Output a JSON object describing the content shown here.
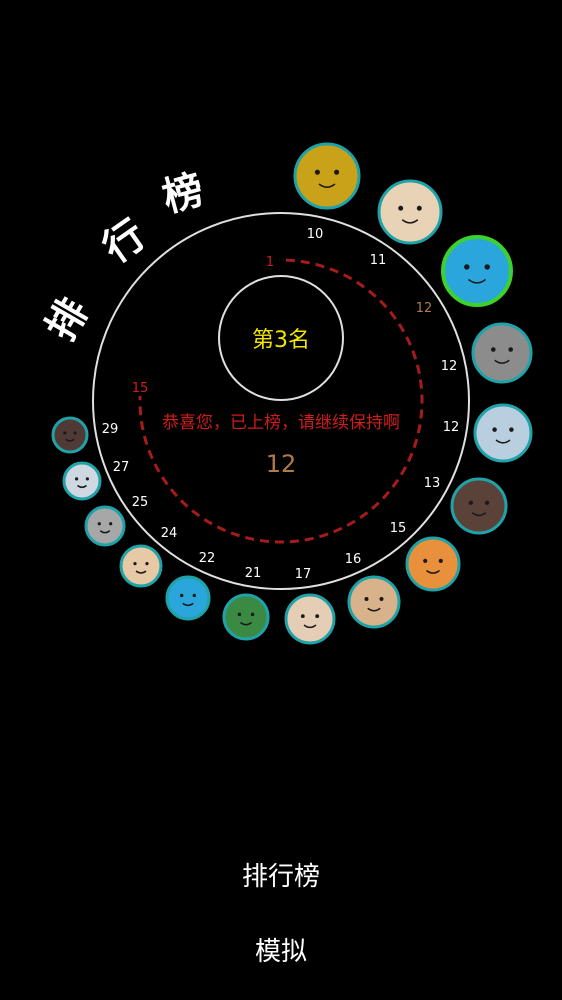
{
  "title_chars": [
    "排",
    "行",
    "榜"
  ],
  "rank_text": "第3名",
  "message": "恭喜您，已上榜，请继续保持啊",
  "score": "12",
  "arc_start_label": "1",
  "arc_end_label": "15",
  "ring_labels": [
    "10",
    "11",
    "12",
    "12",
    "12",
    "13",
    "15",
    "16",
    "17",
    "21",
    "22",
    "24",
    "25",
    "27",
    "29"
  ],
  "highlight_index": 2,
  "avatars": [
    {
      "name": "avatar-emoji-face",
      "color": "#c9a21a"
    },
    {
      "name": "avatar-girl-pink-dress",
      "color": "#e8d3b7"
    },
    {
      "name": "avatar-blue-monster",
      "color": "#2aa6dd"
    },
    {
      "name": "avatar-gray-sketch-boy",
      "color": "#8c8c8c"
    },
    {
      "name": "avatar-cartoon-rabbit",
      "color": "#b9cfe0"
    },
    {
      "name": "avatar-girl-dark-hair",
      "color": "#5a4238"
    },
    {
      "name": "avatar-boy-orange-shirt",
      "color": "#e8903c"
    },
    {
      "name": "avatar-blond-kid",
      "color": "#d7b28a"
    },
    {
      "name": "avatar-red-hair-girl",
      "color": "#e6cdb5"
    },
    {
      "name": "avatar-boy-green-shirt",
      "color": "#3a8a44"
    },
    {
      "name": "avatar-blue-monster-small",
      "color": "#2aa6dd"
    },
    {
      "name": "avatar-girl-long-hair",
      "color": "#e7c9a6"
    },
    {
      "name": "avatar-sketch-character",
      "color": "#a7a7a7"
    },
    {
      "name": "avatar-sketch-rabbit",
      "color": "#cfd8e0"
    },
    {
      "name": "avatar-dark-hair-child",
      "color": "#503a35"
    }
  ],
  "colors": {
    "ring": "#e0e0e0",
    "dash_arc": "#a61c1c",
    "rank_text": "#f2e600",
    "message": "#d01c1c",
    "score": "#b07a4a",
    "highlight_label": "#b07a4a",
    "avatar_border": "#1fa3a8",
    "highlight_border": "#3dd12e"
  },
  "bottom_buttons": {
    "leaderboard": "排行榜",
    "simulate": "模拟"
  }
}
